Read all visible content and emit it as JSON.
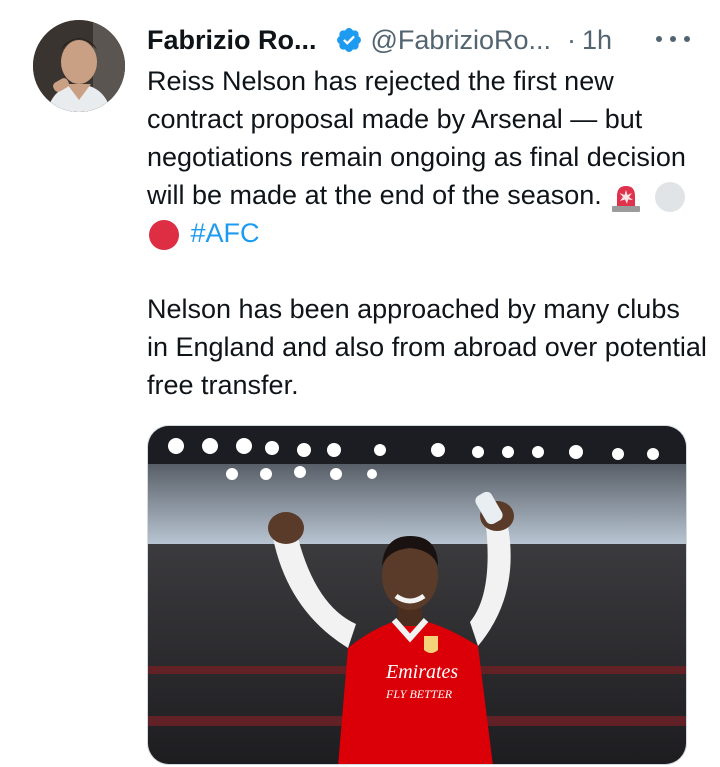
{
  "tweet": {
    "author_name": "Fabrizio Ro...",
    "handle": "@FabrizioRo...",
    "separator": "·",
    "time": "1h",
    "text_line_1": "Reiss Nelson has rejected the first new contract proposal made by Arsenal — but negotiations remain ongoing as final decision will be made at the end of the season.",
    "emojis": [
      "rotating-light-icon",
      "white-circle-icon",
      "red-circle-icon"
    ],
    "hashtag": "#AFC",
    "text_line_2": "Nelson has been approached by many clubs in England and also from abroad over potential free transfer.",
    "jersey_text_1": "Emirates",
    "jersey_text_2": "FLY BETTER"
  },
  "colors": {
    "link": "#1d9bf0",
    "muted": "#536471",
    "verified": "#1d9bf0",
    "arsenal_red": "#db0007"
  }
}
